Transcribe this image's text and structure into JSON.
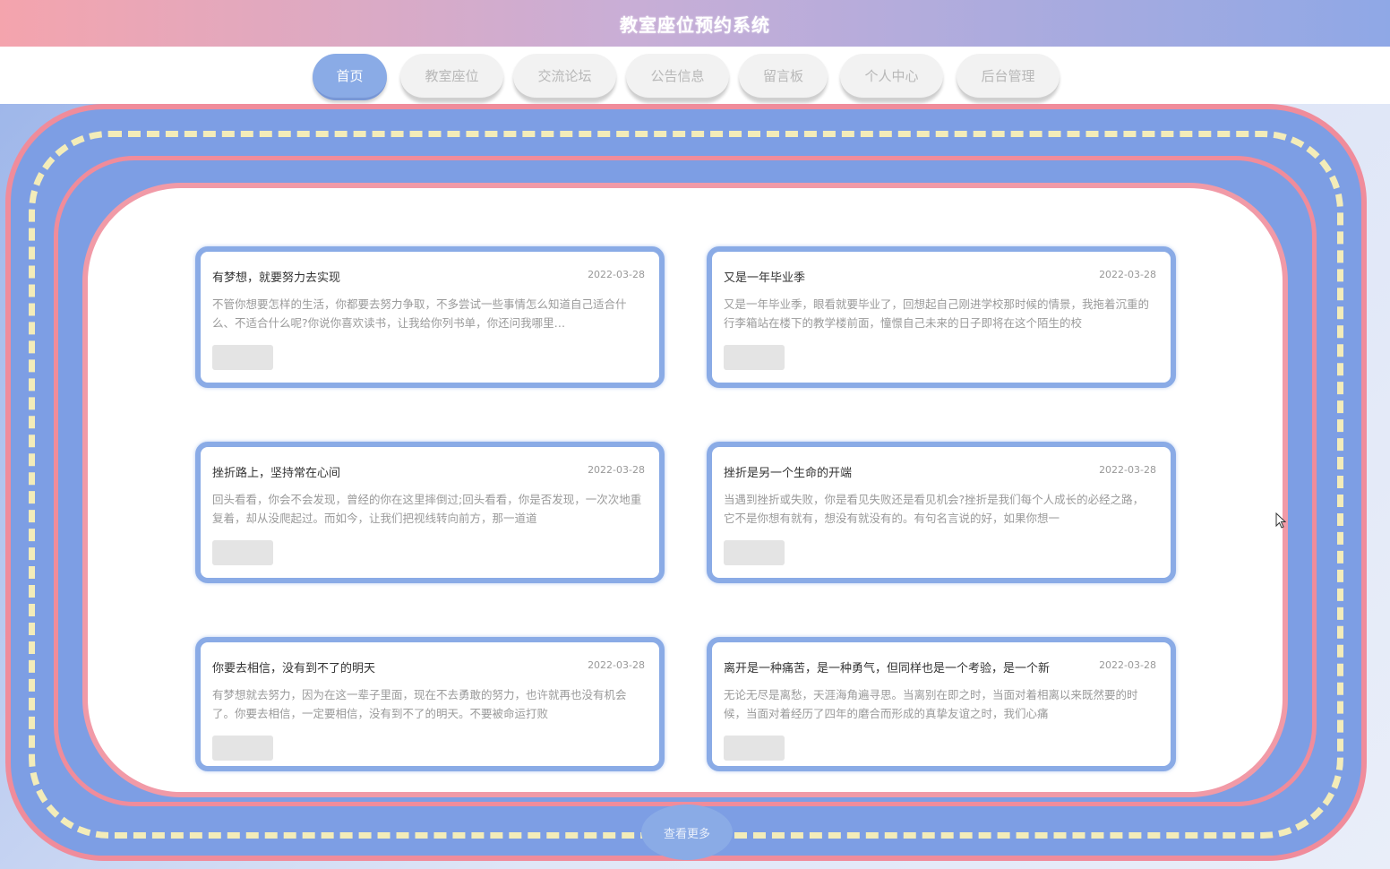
{
  "header": {
    "title": "教室座位预约系统"
  },
  "nav": {
    "tabs": [
      {
        "label": "首页",
        "active": true
      },
      {
        "label": "教室座位",
        "active": false
      },
      {
        "label": "交流论坛",
        "active": false
      },
      {
        "label": "公告信息",
        "active": false
      },
      {
        "label": "留言板",
        "active": false
      },
      {
        "label": "个人中心",
        "active": false
      },
      {
        "label": "后台管理",
        "active": false
      }
    ]
  },
  "cards": [
    {
      "title": "有梦想，就要努力去实现",
      "date": "2022-03-28",
      "body": "不管你想要怎样的生活，你都要去努力争取，不多尝试一些事情怎么知道自己适合什么、不适合什么呢?你说你喜欢读书，让我给你列书单，你还问我哪里…"
    },
    {
      "title": "又是一年毕业季",
      "date": "2022-03-28",
      "body": "又是一年毕业季，眼看就要毕业了，回想起自己刚进学校那时候的情景，我拖着沉重的行李箱站在楼下的教学楼前面，憧憬自己未来的日子即将在这个陌生的校"
    },
    {
      "title": "挫折路上，坚持常在心间",
      "date": "2022-03-28",
      "body": "回头看看，你会不会发现，曾经的你在这里摔倒过;回头看看，你是否发现，一次次地重复着，却从没爬起过。而如今，让我们把视线转向前方，那一道道"
    },
    {
      "title": "挫折是另一个生命的开端",
      "date": "2022-03-28",
      "body": "当遇到挫折或失败，你是看见失败还是看见机会?挫折是我们每个人成长的必经之路，它不是你想有就有，想没有就没有的。有句名言说的好，如果你想一"
    },
    {
      "title": "你要去相信，没有到不了的明天",
      "date": "2022-03-28",
      "body": "有梦想就去努力，因为在这一辈子里面，现在不去勇敢的努力，也许就再也没有机会了。你要去相信，一定要相信，没有到不了的明天。不要被命运打败"
    },
    {
      "title": "离开是一种痛苦，是一种勇气，但同样也是一个考验，是一个新",
      "date": "2022-03-28",
      "body": "无论无尽是离愁，天涯海角遍寻思。当离别在即之时，当面对着相离以来既然要的时候，当面对着经历了四年的磨合而形成的真挚友谊之时，我们心痛"
    }
  ],
  "more_button": {
    "label": "查看更多"
  },
  "colors": {
    "accent_blue": "#8aabe6",
    "accent_pink": "#f08c9b",
    "dash_yellow": "#f3ecb9"
  }
}
